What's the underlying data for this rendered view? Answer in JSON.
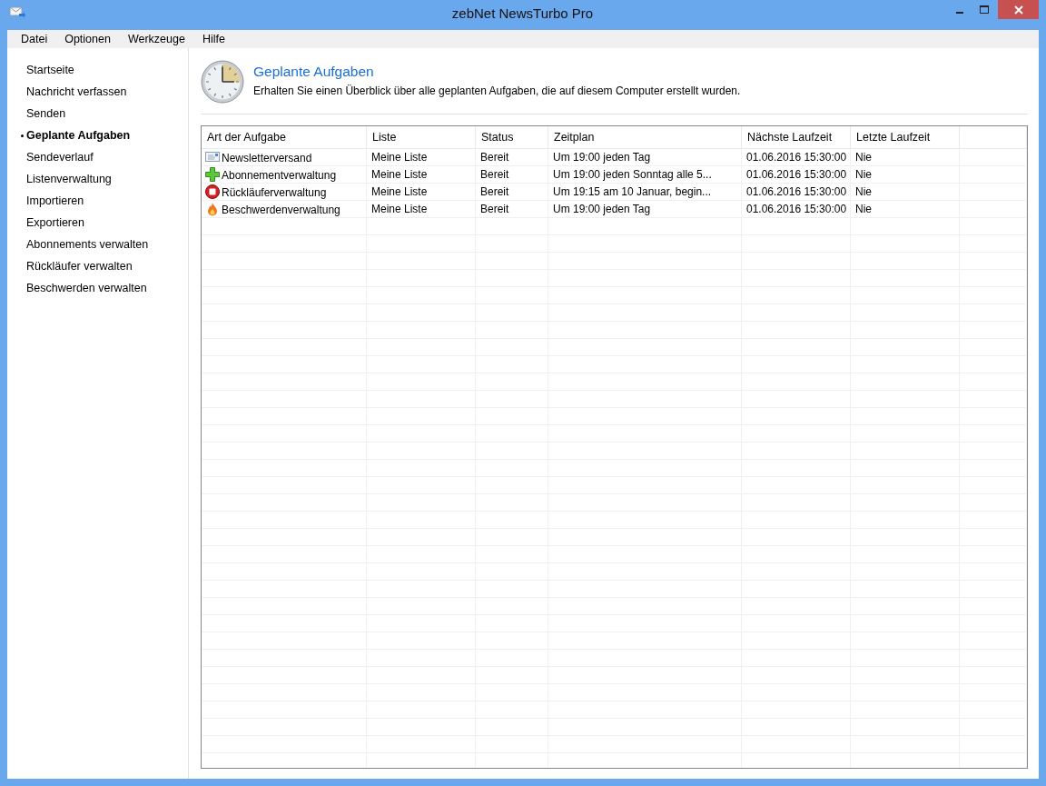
{
  "window": {
    "title": "zebNet NewsTurbo Pro"
  },
  "menu": [
    "Datei",
    "Optionen",
    "Werkzeuge",
    "Hilfe"
  ],
  "sidebar": {
    "items": [
      {
        "label": "Startseite",
        "selected": false
      },
      {
        "label": "Nachricht verfassen",
        "selected": false
      },
      {
        "label": "Senden",
        "selected": false
      },
      {
        "label": "Geplante Aufgaben",
        "selected": true
      },
      {
        "label": "Sendeverlauf",
        "selected": false
      },
      {
        "label": "Listenverwaltung",
        "selected": false
      },
      {
        "label": "Importieren",
        "selected": false
      },
      {
        "label": "Exportieren",
        "selected": false
      },
      {
        "label": "Abonnements verwalten",
        "selected": false
      },
      {
        "label": "Rückläufer verwalten",
        "selected": false
      },
      {
        "label": "Beschwerden verwalten",
        "selected": false
      }
    ]
  },
  "header": {
    "title": "Geplante Aufgaben",
    "description": "Erhalten Sie einen Überblick über alle geplanten Aufgaben, die auf diesem Computer erstellt wurden."
  },
  "table": {
    "columns": [
      "Art der Aufgabe",
      "Liste",
      "Status",
      "Zeitplan",
      "Nächste Laufzeit",
      "Letzte Laufzeit"
    ],
    "rows": [
      {
        "kind": "newsletter",
        "cells": [
          "Newsletterversand",
          "Meine Liste",
          "Bereit",
          "Um 19:00 jeden Tag",
          "01.06.2016 15:30:00",
          "Nie"
        ]
      },
      {
        "kind": "subscription",
        "cells": [
          "Abonnementverwaltung",
          "Meine Liste",
          "Bereit",
          "Um 19:00 jeden Sonntag alle 5...",
          "01.06.2016 15:30:00",
          "Nie"
        ]
      },
      {
        "kind": "bounce",
        "cells": [
          "Rückläuferverwaltung",
          "Meine Liste",
          "Bereit",
          "Um 19:15 am 10 Januar, begin...",
          "01.06.2016 15:30:00",
          "Nie"
        ]
      },
      {
        "kind": "complaint",
        "cells": [
          "Beschwerdenverwaltung",
          "Meine Liste",
          "Bereit",
          "Um 19:00 jeden Tag",
          "01.06.2016 15:30:00",
          "Nie"
        ]
      }
    ]
  }
}
